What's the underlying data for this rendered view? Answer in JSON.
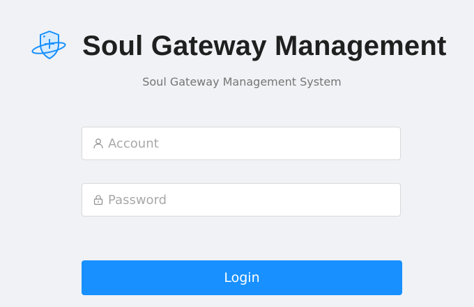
{
  "header": {
    "title": "Soul Gateway Management",
    "subtitle": "Soul Gateway Management System",
    "logo_icon": "shield-plus-orbit-icon"
  },
  "form": {
    "account": {
      "placeholder": "Account",
      "value": "",
      "icon": "user-icon"
    },
    "password": {
      "placeholder": "Password",
      "value": "",
      "icon": "lock-icon"
    },
    "login_label": "Login"
  },
  "colors": {
    "background": "#f0f2f5",
    "primary": "#1890ff",
    "title": "#1f1f1f",
    "subtitle": "#757575",
    "placeholder": "#a8a8a8"
  }
}
